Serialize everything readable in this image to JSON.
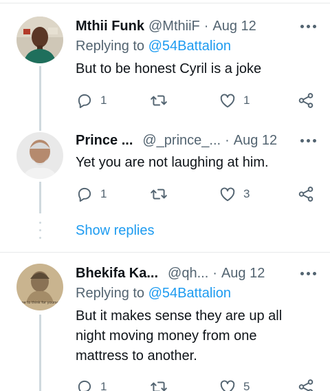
{
  "tweets": [
    {
      "name": "Mthii Funk",
      "handle": "@MthiiF",
      "date": "Aug 12",
      "replying_prefix": "Replying to",
      "replying_to": "@54Battalion",
      "text": "But to be honest Cyril is a joke",
      "replies": "1",
      "retweets": "",
      "likes": "1"
    },
    {
      "name": "Prince ...",
      "handle": "@_prince_...",
      "date": "Aug 12",
      "text": "Yet you are not laughing at him.",
      "replies": "1",
      "retweets": "",
      "likes": "3"
    },
    {
      "name": "Bhekifa Ka...",
      "handle": "@qh...",
      "date": "Aug 12",
      "replying_prefix": "Replying to",
      "replying_to": "@54Battalion",
      "text": "But it makes sense they are up all night moving money from one mattress to another.",
      "replies": "1",
      "retweets": "",
      "likes": "5",
      "avatar_caption": "Free to think for yourself"
    }
  ],
  "show_replies": "Show replies",
  "separator_dot": "·",
  "icons": {
    "reply": "reply-icon",
    "retweet": "retweet-icon",
    "like": "like-icon",
    "share": "share-icon",
    "more": "more-icon"
  },
  "colors": {
    "accent": "#1d9bf0",
    "muted": "#536471",
    "text": "#0f1419",
    "thread_line": "#cfd9de"
  }
}
